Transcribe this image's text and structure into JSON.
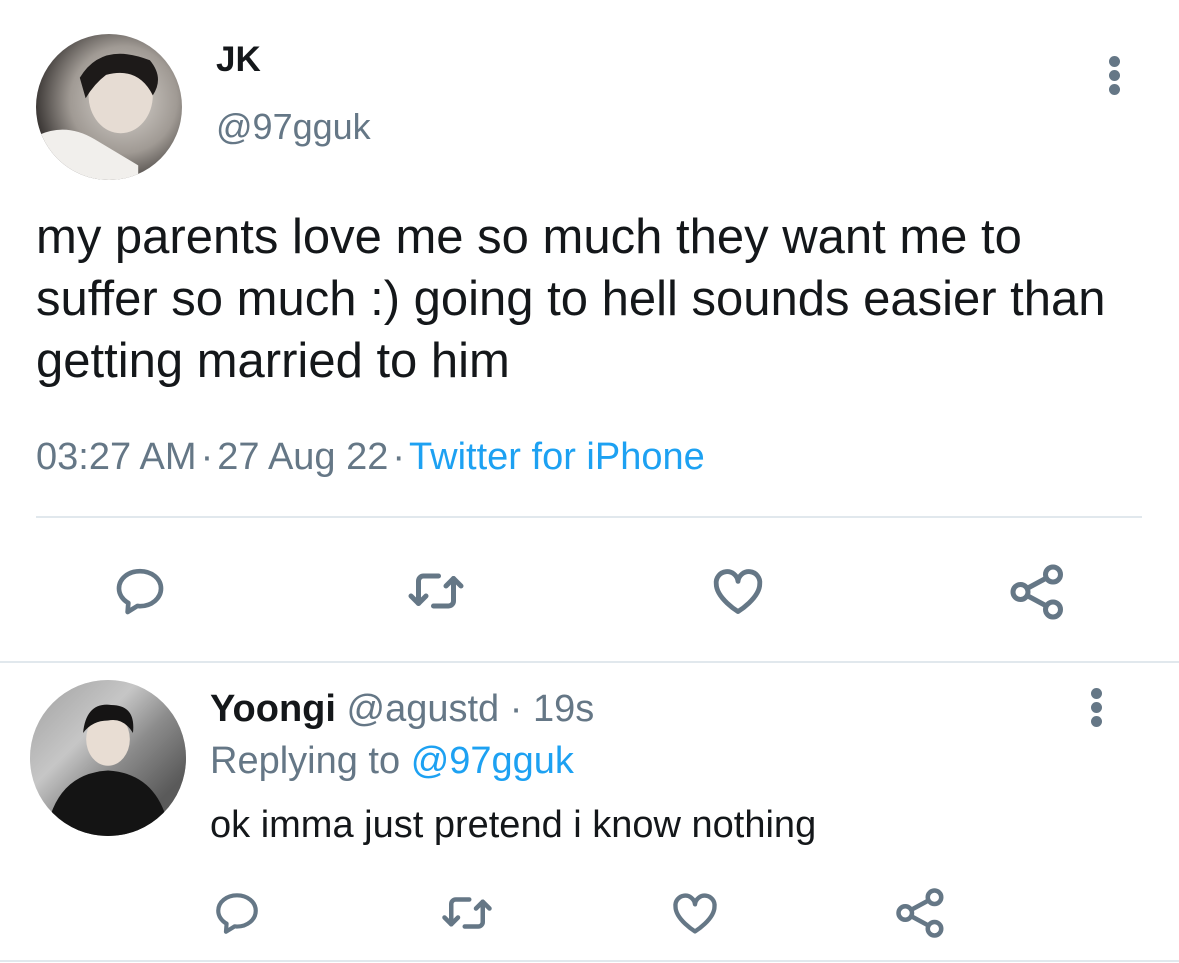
{
  "tweet": {
    "display_name": "JK",
    "handle": "@97gguk",
    "text": "my parents love me so much they want me to suffer so much :) going to hell sounds easier than getting married to him",
    "time": "03:27 AM",
    "date": "27 Aug 22",
    "source": "Twitter for iPhone",
    "separator": "·",
    "more_icon": "more-vertical-icon",
    "actions": [
      "reply-icon",
      "retweet-icon",
      "like-icon",
      "share-icon"
    ]
  },
  "reply": {
    "display_name": "Yoongi",
    "handle": "@agustd",
    "separator": "·",
    "age": "19s",
    "replying_prefix": "Replying to",
    "replying_handle": "@97gguk",
    "text": "ok imma just pretend i know nothing",
    "more_icon": "more-vertical-icon",
    "actions": [
      "reply-icon",
      "retweet-icon",
      "like-icon",
      "share-icon"
    ]
  },
  "colors": {
    "text": "#14171a",
    "secondary": "#657786",
    "accent": "#1da1f2",
    "divider": "#e1e8ed",
    "icon": "#657786"
  }
}
